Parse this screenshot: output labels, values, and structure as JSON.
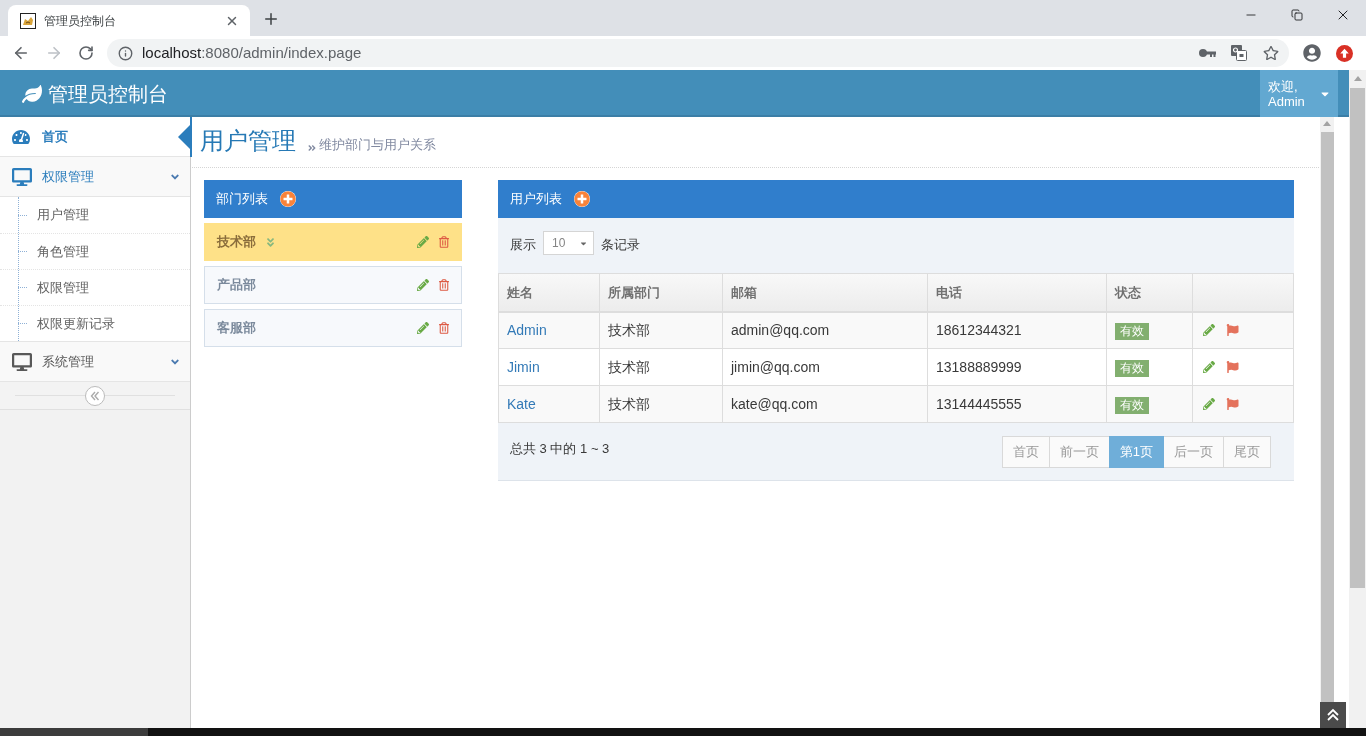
{
  "browser": {
    "tab": {
      "title": "管理员控制台"
    },
    "address": {
      "host": "localhost",
      "path": ":8080/admin/index.page"
    }
  },
  "navbar": {
    "brand": "管理员控制台",
    "user_menu": {
      "greeting": "欢迎,",
      "name": "Admin"
    }
  },
  "sidebar": {
    "items": [
      {
        "kind": "link",
        "label": "首页",
        "selected": true
      },
      {
        "kind": "menu",
        "label": "权限管理",
        "selected": false,
        "expanded": true,
        "children": [
          {
            "label": "用户管理",
            "selected": false
          },
          {
            "label": "角色管理",
            "selected": false
          },
          {
            "label": "权限管理",
            "selected": false
          },
          {
            "label": "权限更新记录",
            "selected": false
          }
        ]
      },
      {
        "kind": "menu",
        "label": "系统管理",
        "selected": false,
        "expanded": false
      }
    ]
  },
  "page_header": {
    "title": "用户管理",
    "subtitle": "维护部门与用户关系"
  },
  "departments": {
    "title": "部门列表",
    "items": [
      {
        "name": "技术部",
        "selected": true
      },
      {
        "name": "产品部",
        "selected": false
      },
      {
        "name": "客服部",
        "selected": false
      }
    ]
  },
  "users": {
    "title": "用户列表",
    "length_menu": {
      "before": "展示",
      "value": "10",
      "after": "条记录"
    },
    "columns": [
      "姓名",
      "所属部门",
      "邮箱",
      "电话",
      "状态"
    ],
    "rows": [
      {
        "name": "Admin",
        "department": "技术部",
        "email": "admin@qq.com",
        "phone": "18612344321",
        "status": "有效"
      },
      {
        "name": "Jimin",
        "department": "技术部",
        "email": "jimin@qq.com",
        "phone": "13188889999",
        "status": "有效"
      },
      {
        "name": "Kate",
        "department": "技术部",
        "email": "kate@qq.com",
        "phone": "13144445555",
        "status": "有效"
      }
    ],
    "summary": "总共 3 中的 1 ~ 3",
    "pagination": [
      {
        "label": "首页",
        "selected": false
      },
      {
        "label": "前一页",
        "selected": false
      },
      {
        "label": "第1页",
        "selected": true
      },
      {
        "label": "后一页",
        "selected": false
      },
      {
        "label": "尾页",
        "selected": false
      }
    ]
  }
}
